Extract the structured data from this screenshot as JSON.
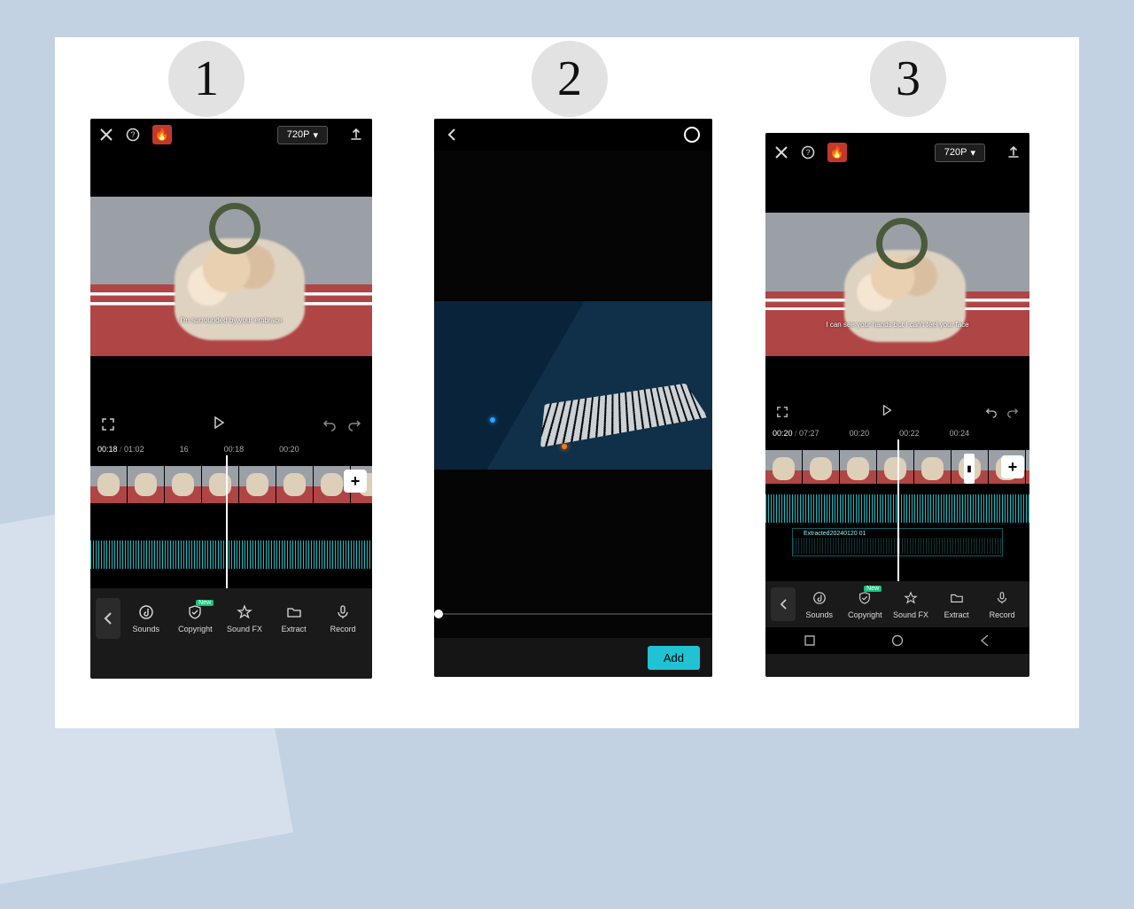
{
  "steps": {
    "one": "1",
    "two": "2",
    "three": "3"
  },
  "phone1": {
    "resolution": "720P",
    "caption": "I'm surrounded by your embrace",
    "time_current": "00:18",
    "time_total": "01:02",
    "ruler": [
      "16",
      "00:18",
      "00:20"
    ],
    "tools": {
      "sounds": "Sounds",
      "copyright": "Copyright",
      "soundfx": "Sound FX",
      "extract": "Extract",
      "record": "Record",
      "new_badge": "New"
    }
  },
  "phone2": {
    "add_label": "Add"
  },
  "phone3": {
    "resolution": "720P",
    "caption": "I can see your hands but I can't feel your face",
    "time_current": "00:20",
    "time_total": "07:27",
    "ruler": [
      "00:20",
      "00:22",
      "00:24"
    ],
    "extracted_label": "Extracted20240120 01",
    "tools": {
      "sounds": "Sounds",
      "copyright": "Copyright",
      "soundfx": "Sound FX",
      "extract": "Extract",
      "record": "Record",
      "new_badge": "New"
    }
  }
}
